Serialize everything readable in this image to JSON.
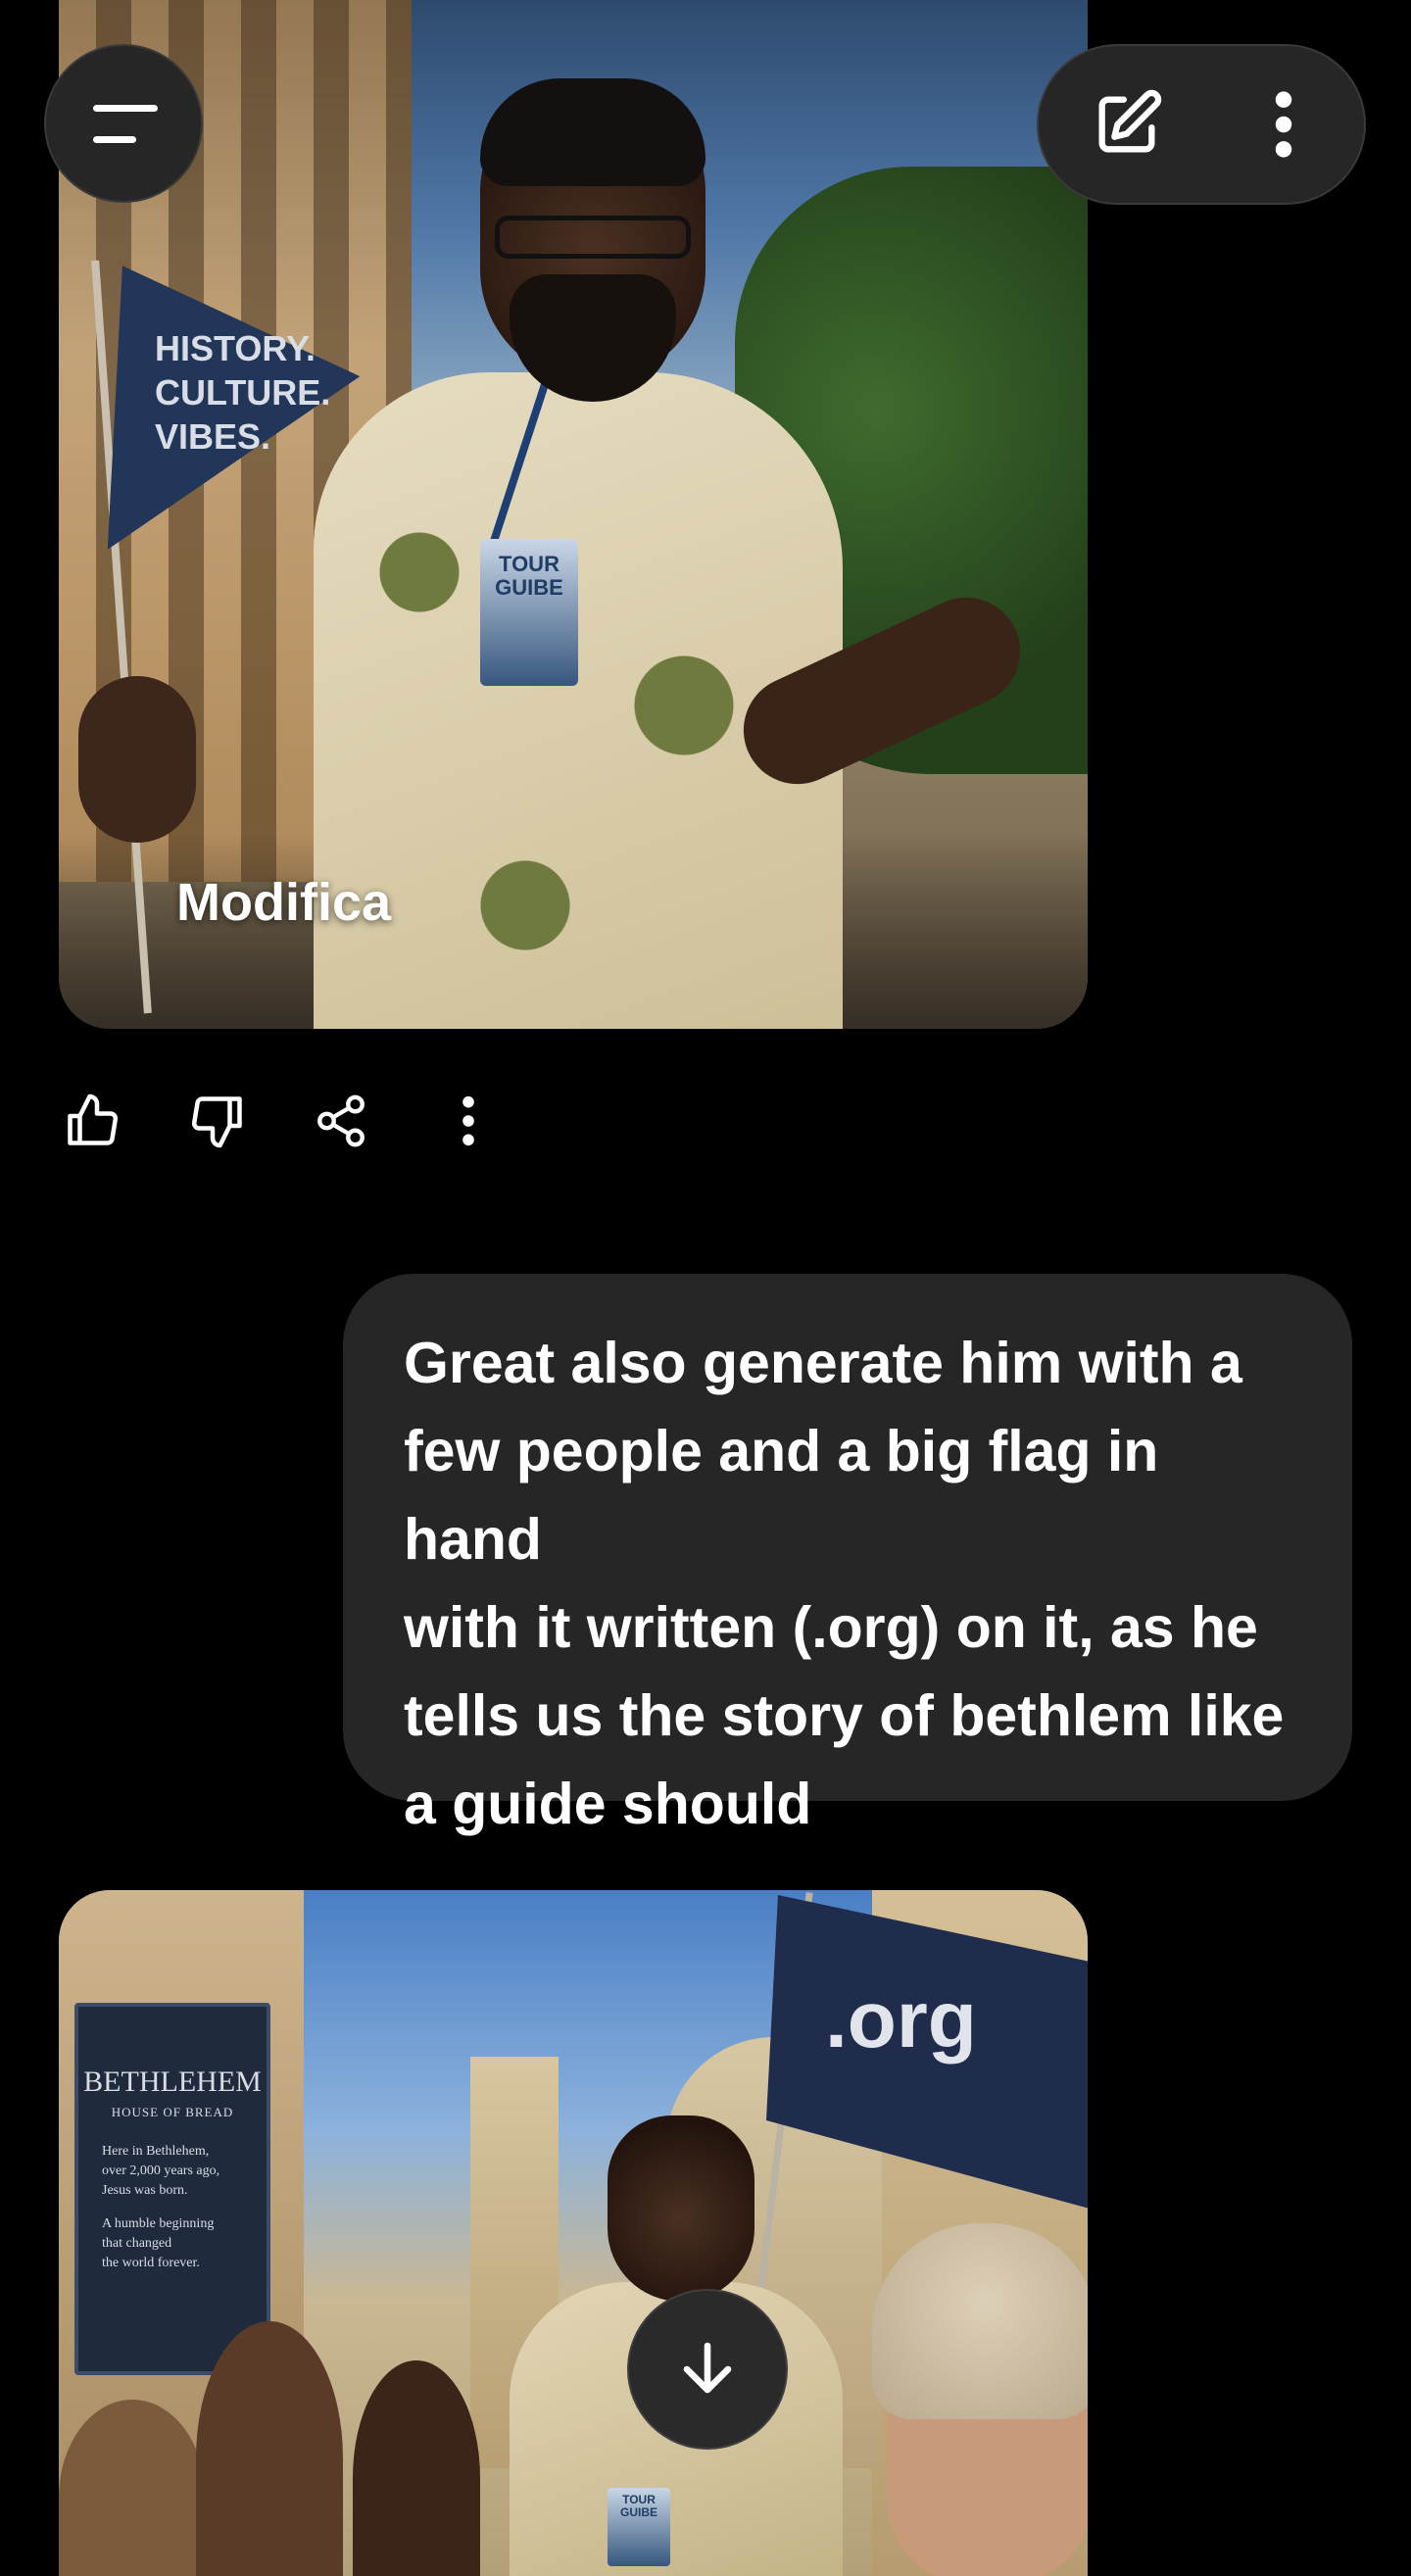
{
  "top_bar": {
    "menu_icon": "menu-icon",
    "new_chat_icon": "edit-pencil-icon",
    "more_icon": "more-vertical-icon"
  },
  "first_image": {
    "flag_text": [
      "HISTORY.",
      "CULTURE.",
      "VIBES."
    ],
    "badge_text": [
      "TOUR",
      "GUIBE"
    ],
    "overlay_label": "Modifica"
  },
  "response_actions": {
    "like_icon": "thumbs-up-icon",
    "dislike_icon": "thumbs-down-icon",
    "share_icon": "share-icon",
    "more_icon": "more-vertical-icon"
  },
  "user_message": {
    "lines": [
      "Great also generate him with a",
      "few people and a big flag in hand",
      "with it written (.org) on it, as he",
      "tells us the story of bethlem like",
      "a guide should"
    ]
  },
  "second_image": {
    "flag_text": ".org",
    "sign": {
      "title": "BETHLEHEM",
      "subtitle": "HOUSE OF BREAD",
      "lines_1": [
        "Here in Bethlehem,",
        "over 2,000 years ago,",
        "Jesus was born."
      ],
      "lines_2": [
        "A humble beginning",
        "that changed",
        "the world forever."
      ]
    },
    "badge_text": [
      "TOUR",
      "GUIBE"
    ]
  },
  "scroll_button": {
    "icon": "arrow-down-icon"
  },
  "colors": {
    "background": "#000000",
    "bubble": "#262626",
    "button": "#262626",
    "text": "#ffffff"
  }
}
